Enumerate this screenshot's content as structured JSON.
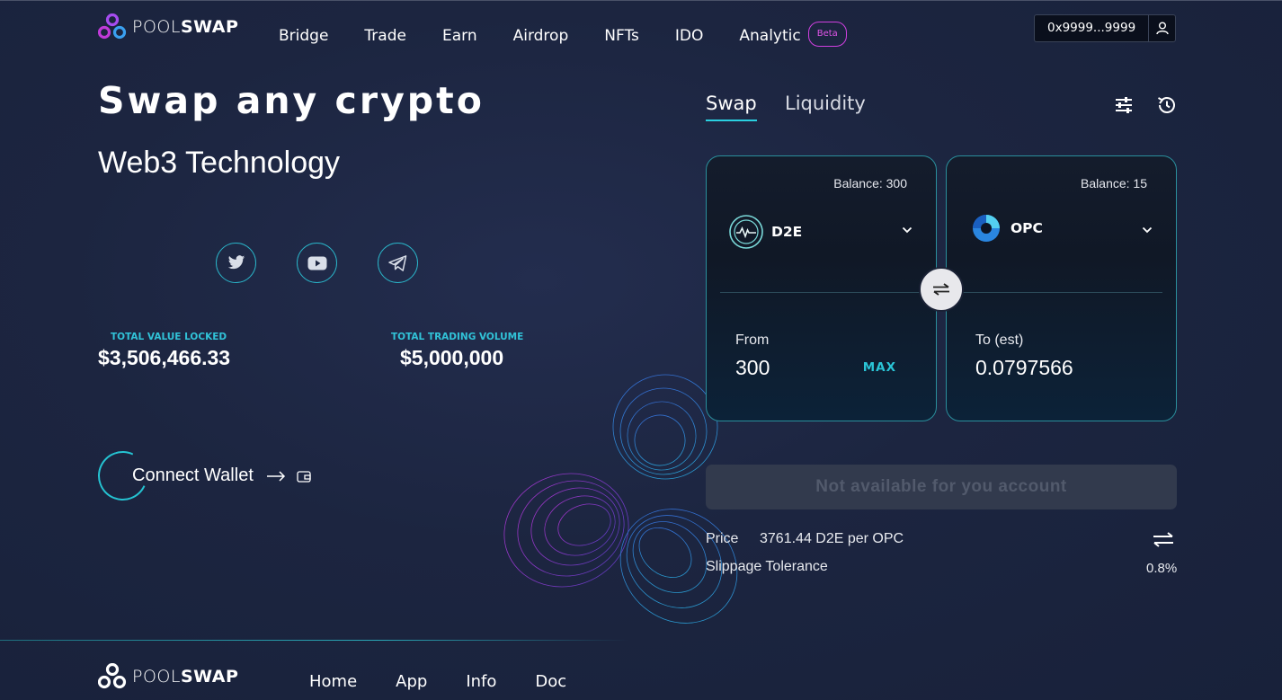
{
  "header": {
    "logo": {
      "text_light": "POOL",
      "text_bold": "SWAP"
    },
    "nav": [
      {
        "label": "Bridge"
      },
      {
        "label": "Trade"
      },
      {
        "label": "Earn"
      },
      {
        "label": "Airdrop"
      },
      {
        "label": "NFTs"
      },
      {
        "label": "IDO"
      },
      {
        "label": "Analytic",
        "badge": "Beta"
      }
    ],
    "wallet_address": "0x9999...9999",
    "user_icon": "user-icon"
  },
  "hero": {
    "title": "Swap any crypto",
    "subtitle": "Web3 Technology",
    "socials": [
      "twitter-icon",
      "youtube-icon",
      "telegram-icon"
    ],
    "stats": [
      {
        "label": "TOTAL VALUE LOCKED",
        "value": "$3,506,466.33"
      },
      {
        "label": "TOTAL TRADING VOLUME",
        "value": "$5,000,000"
      }
    ],
    "connect_label": "Connect Wallet"
  },
  "swap": {
    "tabs": [
      {
        "label": "Swap"
      },
      {
        "label": "Liquidity"
      }
    ],
    "from": {
      "balance": "Balance: 300",
      "token": "D2E",
      "label": "From",
      "value": "300",
      "max_label": "MAX"
    },
    "to": {
      "balance": "Balance: 15",
      "token": "OPC",
      "label": "To (est)",
      "value": "0.0797566"
    },
    "action_label": "Not available for you account",
    "price_label": "Price",
    "price_value": "3761.44 D2E per OPC",
    "slippage_label": "Slippage Tolerance",
    "slippage_value": "0.8%"
  },
  "footer": {
    "logo": {
      "text_light": "POOL",
      "text_bold": "SWAP"
    },
    "nav": [
      {
        "label": "Home"
      },
      {
        "label": "App"
      },
      {
        "label": "Info"
      },
      {
        "label": "Doc"
      }
    ]
  },
  "colors": {
    "accent": "#2ac4d6",
    "beta": "#d040e0",
    "bg": "#1c2540"
  }
}
